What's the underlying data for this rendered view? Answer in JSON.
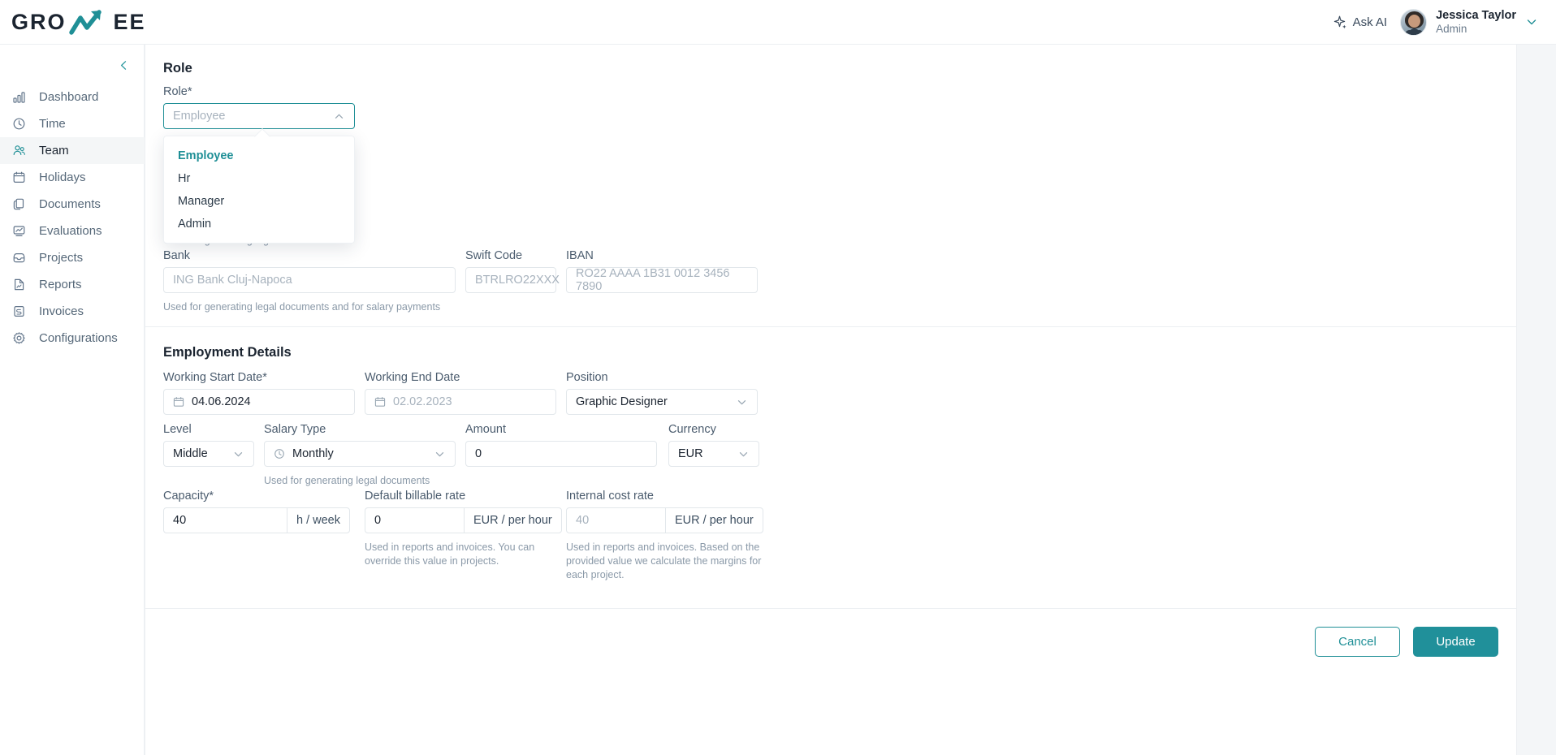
{
  "brand": {
    "left": "GRO",
    "right": "EE",
    "accent": "#1f8f96",
    "logo_icon": "growth-arrow-icon"
  },
  "topbar": {
    "ask_ai_label": "Ask AI",
    "ask_ai_icon": "sparkle-icon",
    "user": {
      "name": "Jessica Taylor",
      "role": "Admin"
    },
    "chevron_icon": "chevron-down-icon"
  },
  "sidebar": {
    "collapse_icon": "chevron-left-icon",
    "items": [
      {
        "label": "Dashboard",
        "icon": "bar-chart-icon",
        "active": false
      },
      {
        "label": "Time",
        "icon": "clock-icon",
        "active": false
      },
      {
        "label": "Team",
        "icon": "users-icon",
        "active": true
      },
      {
        "label": "Holidays",
        "icon": "calendar-icon",
        "active": false
      },
      {
        "label": "Documents",
        "icon": "documents-icon",
        "active": false
      },
      {
        "label": "Evaluations",
        "icon": "evaluation-chart-icon",
        "active": false
      },
      {
        "label": "Projects",
        "icon": "inbox-icon",
        "active": false
      },
      {
        "label": "Reports",
        "icon": "report-file-icon",
        "active": false
      },
      {
        "label": "Invoices",
        "icon": "invoice-icon",
        "active": false
      },
      {
        "label": "Configurations",
        "icon": "gear-icon",
        "active": false
      }
    ]
  },
  "role_section": {
    "title": "Role",
    "field_label": "Role*",
    "select_placeholder": "Employee",
    "select_value": "",
    "chevron_icon": "chevron-up-icon",
    "hint_behind": "Used for generating legal documents",
    "dropdown": {
      "options": [
        "Employee",
        "Hr",
        "Manager",
        "Admin"
      ],
      "selected": "Employee"
    },
    "bank": {
      "label": "Bank",
      "placeholder": "ING Bank Cluj-Napoca",
      "value": ""
    },
    "swift": {
      "label": "Swift Code",
      "placeholder": "BTRLRO22XXX",
      "value": ""
    },
    "iban": {
      "label": "IBAN",
      "placeholder": "RO22 AAAA 1B31 0012 3456 7890",
      "value": ""
    },
    "bank_hint": "Used for generating legal documents and for salary payments"
  },
  "employment_section": {
    "title": "Employment Details",
    "working_start_date": {
      "label": "Working Start Date*",
      "value": "04.06.2024",
      "icon": "calendar-icon"
    },
    "working_end_date": {
      "label": "Working End Date",
      "value": "",
      "placeholder": "02.02.2023",
      "icon": "calendar-icon"
    },
    "position": {
      "label": "Position",
      "value": "Graphic Designer",
      "chevron_icon": "chevron-down-icon"
    },
    "level": {
      "label": "Level",
      "value": "Middle",
      "chevron_icon": "chevron-down-icon"
    },
    "salary_type": {
      "label": "Salary Type",
      "value": "Monthly",
      "icon": "clock-icon",
      "chevron_icon": "chevron-down-icon",
      "hint": "Used for generating legal documents"
    },
    "amount": {
      "label": "Amount",
      "value": "0"
    },
    "currency": {
      "label": "Currency",
      "value": "EUR",
      "chevron_icon": "chevron-down-icon"
    },
    "capacity": {
      "label": "Capacity*",
      "value": "40",
      "suffix": "h / week"
    },
    "default_billable_rate": {
      "label": "Default billable rate",
      "value": "0",
      "suffix": "EUR / per hour",
      "hint": "Used in reports and invoices. You can override this value in projects."
    },
    "internal_cost_rate": {
      "label": "Internal cost rate",
      "value": "",
      "placeholder": "40",
      "suffix": "EUR / per hour",
      "hint": "Used in reports and invoices. Based on the provided value we calculate the margins for each project."
    }
  },
  "footer": {
    "cancel_label": "Cancel",
    "update_label": "Update"
  }
}
